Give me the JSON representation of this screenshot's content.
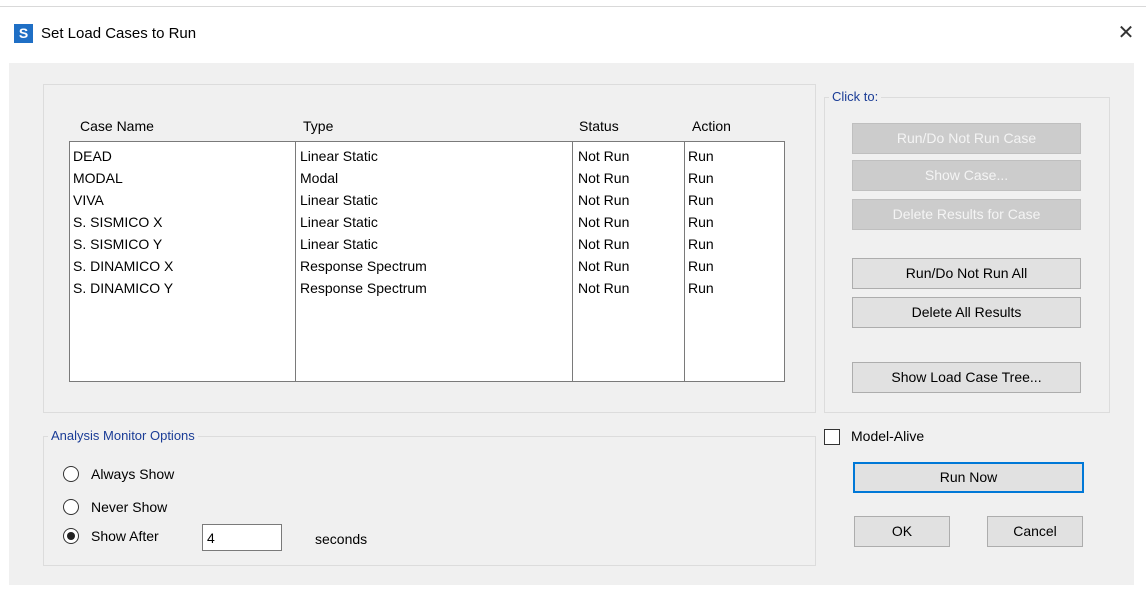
{
  "window": {
    "title": "Set Load Cases to Run",
    "app_icon_letter": "S",
    "close_glyph": "✕",
    "icon": "sap2000-app-icon"
  },
  "case_table": {
    "columns": [
      "Case Name",
      "Type",
      "Status",
      "Action"
    ],
    "rows": [
      {
        "name": "DEAD",
        "type": "Linear Static",
        "status": "Not Run",
        "action": "Run"
      },
      {
        "name": "MODAL",
        "type": "Modal",
        "status": "Not Run",
        "action": "Run"
      },
      {
        "name": "VIVA",
        "type": "Linear Static",
        "status": "Not Run",
        "action": "Run"
      },
      {
        "name": "S. SISMICO X",
        "type": "Linear Static",
        "status": "Not Run",
        "action": "Run"
      },
      {
        "name": "S. SISMICO Y",
        "type": "Linear Static",
        "status": "Not Run",
        "action": "Run"
      },
      {
        "name": "S. DINAMICO X",
        "type": "Response Spectrum",
        "status": "Not Run",
        "action": "Run"
      },
      {
        "name": "S. DINAMICO Y",
        "type": "Response Spectrum",
        "status": "Not Run",
        "action": "Run"
      }
    ]
  },
  "click_to": {
    "label": "Click to:",
    "run_do_not_run_case": "Run/Do Not Run Case",
    "show_case": "Show Case...",
    "delete_results_for_case": "Delete Results for Case",
    "run_do_not_run_all": "Run/Do Not Run All",
    "delete_all_results": "Delete All Results",
    "show_load_case_tree": "Show Load Case Tree..."
  },
  "monitor": {
    "label": "Analysis Monitor Options",
    "always_show": "Always Show",
    "never_show": "Never Show",
    "show_after": "Show After",
    "seconds_value": "4",
    "seconds_label": "seconds",
    "selected": "show_after"
  },
  "actions": {
    "model_alive": "Model-Alive",
    "run_now": "Run Now",
    "ok": "OK",
    "cancel": "Cancel"
  },
  "colors": {
    "accent": "#0078d7",
    "group_label": "#1a3c96",
    "app_icon_bg": "#1f6fc5"
  }
}
